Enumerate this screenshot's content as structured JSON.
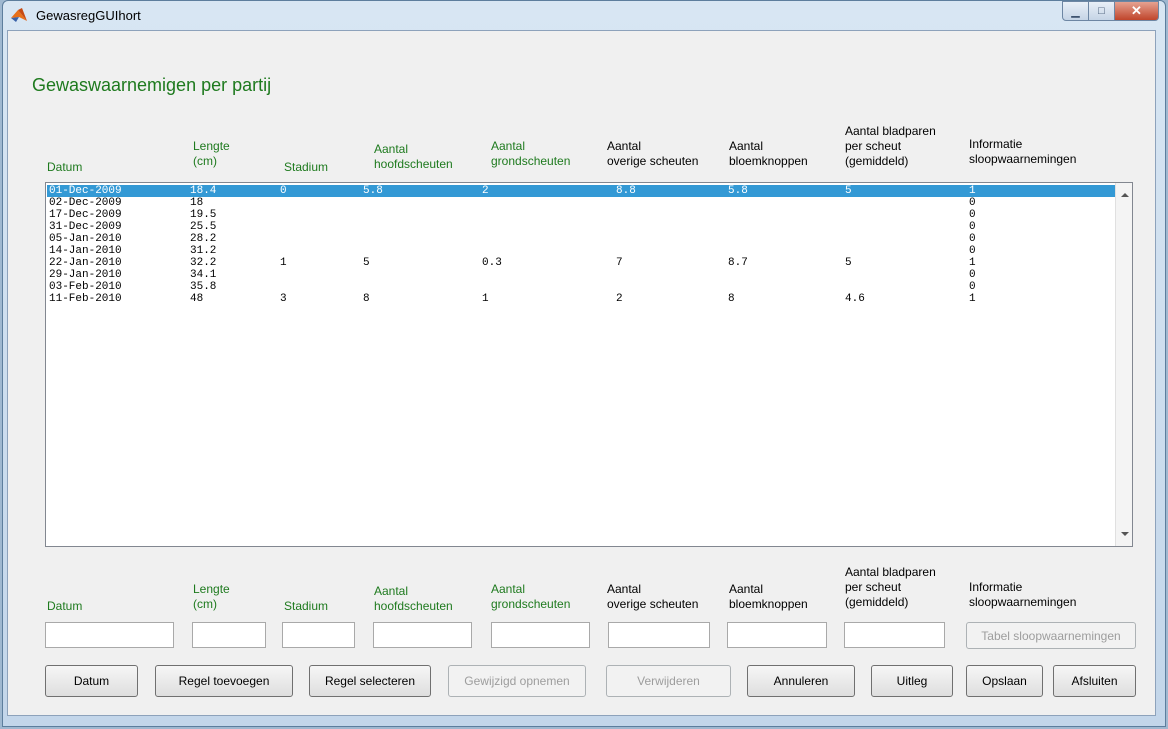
{
  "window": {
    "title": "GewasregGUIhort"
  },
  "heading": "Gewaswaarnemigen per partij",
  "columns": {
    "datum": "Datum",
    "lengte": [
      "Lengte",
      "(cm)"
    ],
    "stadium": "Stadium",
    "hoofd": [
      "Aantal",
      "hoofdscheuten"
    ],
    "grond": [
      "Aantal",
      "grondscheuten"
    ],
    "overig": [
      "Aantal",
      "overige scheuten"
    ],
    "bloem": [
      "Aantal",
      "bloemknoppen"
    ],
    "blad": [
      "Aantal bladparen",
      "per scheut",
      "(gemiddeld)"
    ],
    "info": [
      "Informatie",
      "sloopwaarnemingen"
    ]
  },
  "rows": [
    [
      "01-Dec-2009",
      "18.4",
      "0",
      "5.8",
      "2",
      "8.8",
      "5.8",
      "5",
      "1"
    ],
    [
      "02-Dec-2009",
      "18",
      "",
      "",
      "",
      "",
      "",
      "",
      "0"
    ],
    [
      "17-Dec-2009",
      "19.5",
      "",
      "",
      "",
      "",
      "",
      "",
      "0"
    ],
    [
      "31-Dec-2009",
      "25.5",
      "",
      "",
      "",
      "",
      "",
      "",
      "0"
    ],
    [
      "05-Jan-2010",
      "28.2",
      "",
      "",
      "",
      "",
      "",
      "",
      "0"
    ],
    [
      "14-Jan-2010",
      "31.2",
      "",
      "",
      "",
      "",
      "",
      "",
      "0"
    ],
    [
      "22-Jan-2010",
      "32.2",
      "1",
      "5",
      "0.3",
      "7",
      "8.7",
      "5",
      "1"
    ],
    [
      "29-Jan-2010",
      "34.1",
      "",
      "",
      "",
      "",
      "",
      "",
      "0"
    ],
    [
      "03-Feb-2010",
      "35.8",
      "",
      "",
      "",
      "",
      "",
      "",
      "0"
    ],
    [
      "11-Feb-2010",
      "48",
      "3",
      "8",
      "1",
      "2",
      "8",
      "4.6",
      "1"
    ]
  ],
  "buttons": {
    "tabel": "Tabel sloopwaarnemingen",
    "datum": "Datum",
    "regel_toevoegen": "Regel toevoegen",
    "regel_selecteren": "Regel selecteren",
    "gewijzigd_opnemen": "Gewijzigd opnemen",
    "verwijderen": "Verwijderen",
    "annuleren": "Annuleren",
    "uitleg": "Uitleg",
    "opslaan": "Opslaan",
    "afsluiten": "Afsluiten"
  },
  "colors": {
    "selection": "#3399d5",
    "heading_green": "#1e7a1e"
  }
}
